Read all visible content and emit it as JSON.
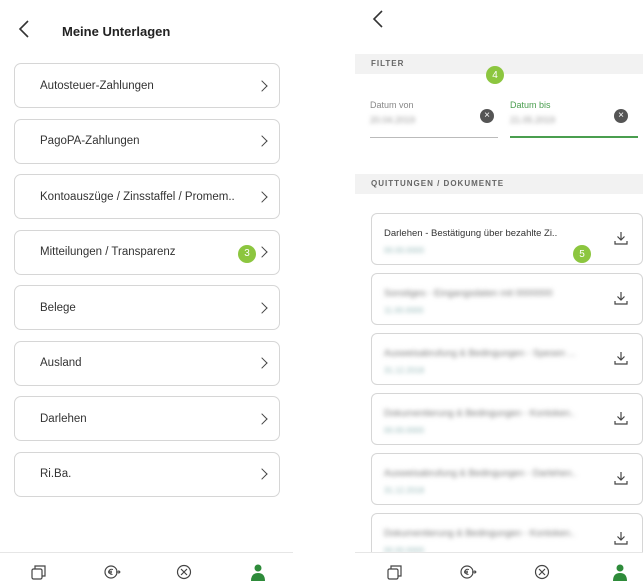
{
  "left": {
    "title": "Meine Unterlagen",
    "items": [
      {
        "label": "Autosteuer-Zahlungen"
      },
      {
        "label": "PagoPA-Zahlungen"
      },
      {
        "label": "Kontoauszüge / Zinsstaffel / Promem.."
      },
      {
        "label": "Mitteilungen / Transparenz",
        "badge": "3"
      },
      {
        "label": "Belege"
      },
      {
        "label": "Ausland"
      },
      {
        "label": "Darlehen"
      },
      {
        "label": "Ri.Ba."
      }
    ]
  },
  "right": {
    "filter_heading": "FILTER",
    "badge4": "4",
    "date_from_label": "Datum von",
    "date_from_value": "20.04.2019",
    "date_to_label": "Datum bis",
    "date_to_value": "21.05.2019",
    "docs_heading": "QUITTUNGEN / DOKUMENTE",
    "badge5": "5",
    "docs": [
      {
        "title": "Darlehen - Bestätigung über bezahlte Zi..",
        "date": "00.00.0000"
      },
      {
        "title": "Sonstiges - Eingangsdaten mit 0000000",
        "date": "11.00.0000"
      },
      {
        "title": "Ausweisabrufung & Bedingungen - Spesen ...",
        "date": "31.12.2018"
      },
      {
        "title": "Dokumentierung & Bedingungen - Kontoken..",
        "date": "00.00.0000"
      },
      {
        "title": "Ausweisabrufung & Bedingungen - Darlehen..",
        "date": "31.12.2018"
      },
      {
        "title": "Dokumentierung & Bedingungen - Kontoken..",
        "date": "00.00.0000"
      }
    ]
  },
  "colors": {
    "accent_green": "#8cc63f",
    "active_green": "#4a9e4f"
  },
  "icons": [
    "back-chevron-icon",
    "chevron-right-icon",
    "clear-icon",
    "download-icon",
    "cards-icon",
    "euro-transfer-icon",
    "cancel-circle-icon",
    "profile-icon"
  ]
}
